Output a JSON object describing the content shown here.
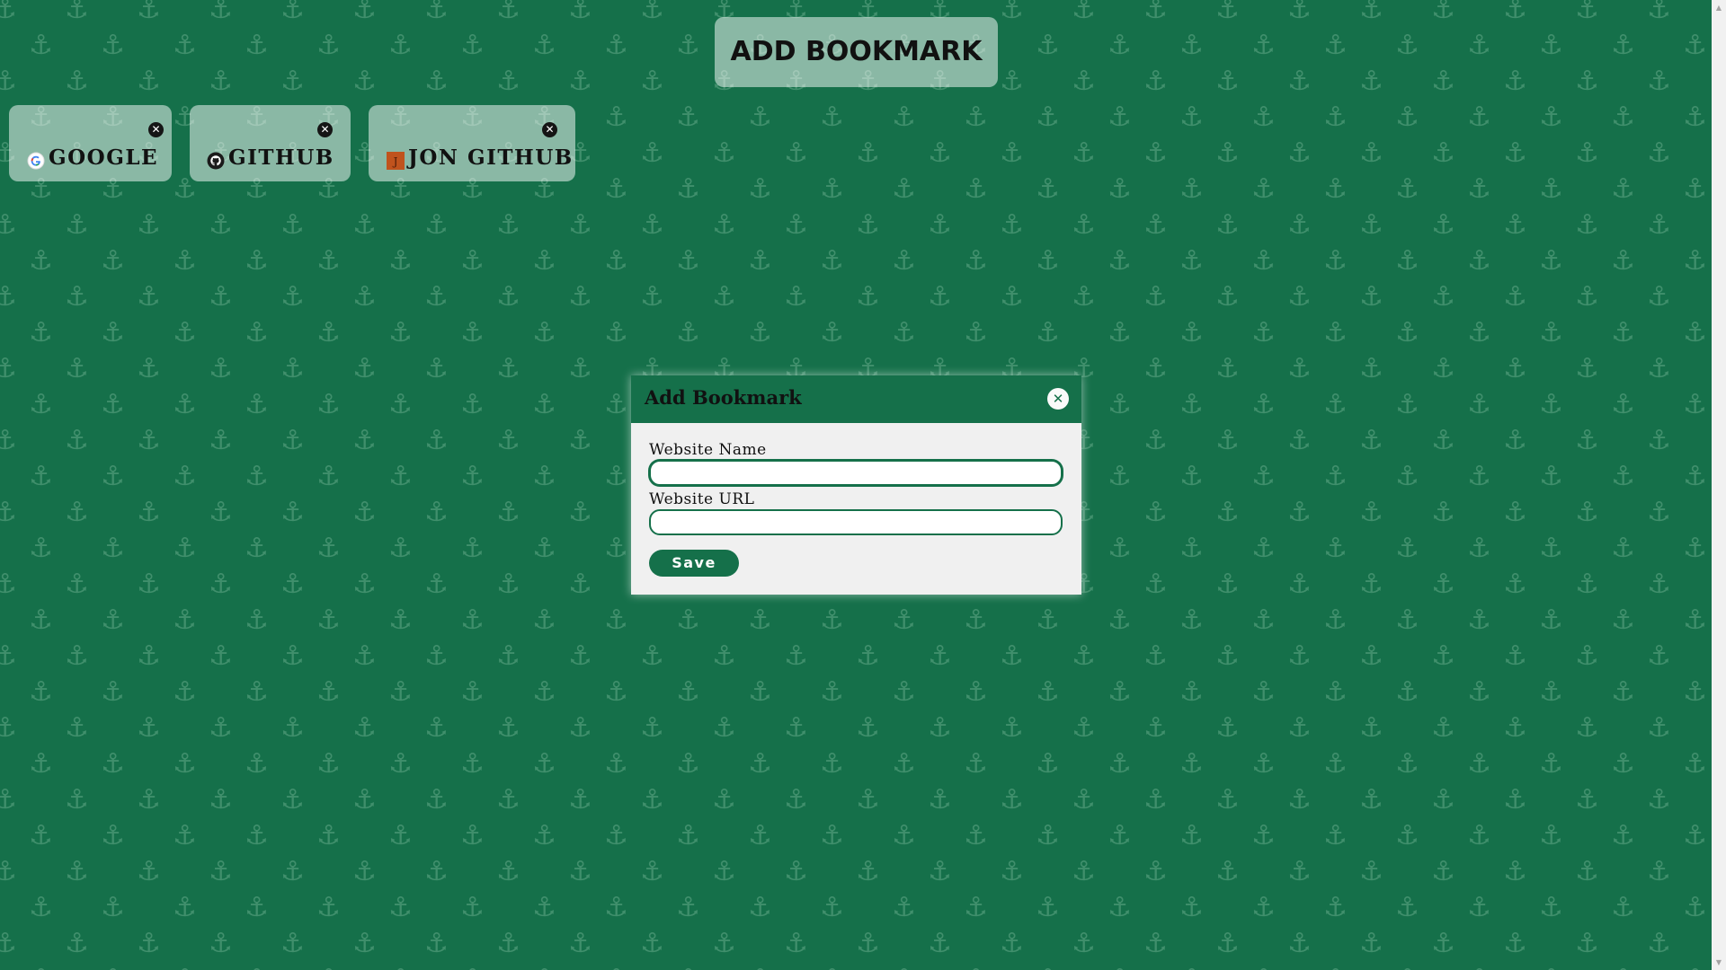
{
  "colors": {
    "background": "#15704a",
    "pattern": "#4f9a78",
    "card": "rgba(255,255,255,0.5)",
    "modal": "#f0f0f0",
    "accent": "#15704a"
  },
  "header": {
    "add_bookmark_label": "ADD BOOKMARK"
  },
  "bookmarks": [
    {
      "label": "GOOGLE",
      "icon": "google-favicon",
      "delete_icon": "close-circle-icon"
    },
    {
      "label": "GITHUB",
      "icon": "github-favicon",
      "delete_icon": "close-circle-icon"
    },
    {
      "label": "JON GITHUB",
      "icon": "j-favicon",
      "favicon_letter": "J",
      "delete_icon": "close-circle-icon"
    }
  ],
  "modal": {
    "title": "Add Bookmark",
    "close_icon": "close-circle-icon",
    "fields": [
      {
        "label": "Website Name",
        "value": "",
        "placeholder": ""
      },
      {
        "label": "Website URL",
        "value": "",
        "placeholder": ""
      }
    ],
    "save_label": "Save"
  },
  "background_icon": "anchor-icon"
}
